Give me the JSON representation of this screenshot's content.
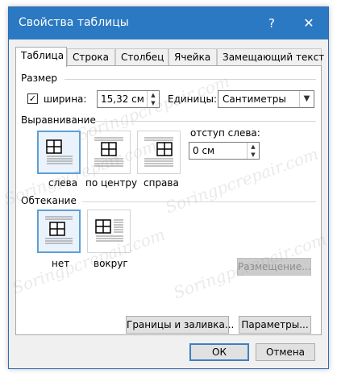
{
  "window": {
    "title": "Свойства таблицы",
    "help": "?",
    "close": "✕"
  },
  "tabs": [
    {
      "label": "Таблица",
      "active": true
    },
    {
      "label": "Строка",
      "active": false
    },
    {
      "label": "Столбец",
      "active": false
    },
    {
      "label": "Ячейка",
      "active": false
    },
    {
      "label": "Замещающий текст",
      "active": false
    }
  ],
  "size": {
    "group_label": "Размер",
    "width_checked": true,
    "width_label": "ширина:",
    "width_value": "15,32 см",
    "units_label": "Единицы:",
    "units_value": "Сантиметры"
  },
  "alignment": {
    "group_label": "Выравнивание",
    "options": [
      {
        "label": "слева",
        "selected": true
      },
      {
        "label": "по центру",
        "selected": false
      },
      {
        "label": "справа",
        "selected": false
      }
    ],
    "indent_label": "отступ слева:",
    "indent_value": "0 см"
  },
  "wrapping": {
    "group_label": "Обтекание",
    "options": [
      {
        "label": "нет",
        "selected": true
      },
      {
        "label": "вокруг",
        "selected": false
      }
    ],
    "positioning_button": "Размещение..."
  },
  "buttons": {
    "borders": "Границы и заливка...",
    "options": "Параметры...",
    "ok": "ОК",
    "cancel": "Отмена"
  },
  "watermark": "Soringpcrepair.com",
  "colors": {
    "titlebar": "#2b79c2",
    "selection": "#5e9fd6"
  }
}
